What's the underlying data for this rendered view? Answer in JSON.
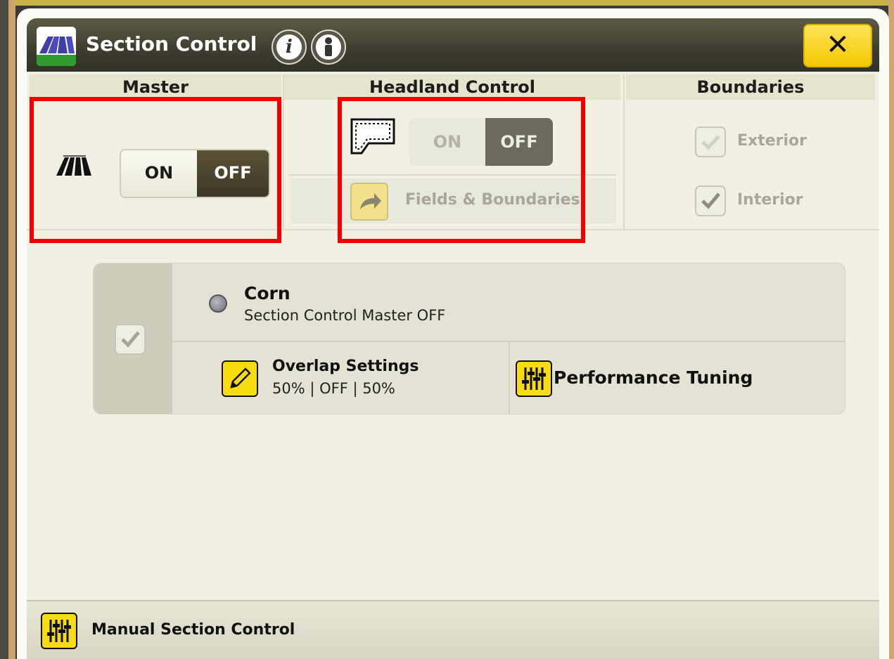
{
  "window": {
    "title": "Section Control",
    "close_symbol": "✕",
    "info_symbols": [
      "i",
      "i"
    ],
    "icons": [
      "section-control-app-icon",
      "info-icon",
      "operator-info-icon",
      "close-icon"
    ]
  },
  "master": {
    "header": "Master",
    "toggle": {
      "on_label": "ON",
      "off_label": "OFF",
      "selected": "OFF"
    }
  },
  "headland": {
    "header": "Headland Control",
    "toggle": {
      "on_label": "ON",
      "off_label": "OFF",
      "selected": "OFF",
      "enabled": false
    },
    "fields_button_label": "Fields & Boundaries"
  },
  "boundaries": {
    "header": "Boundaries",
    "options": [
      {
        "label": "Exterior",
        "checked": true,
        "enabled": false
      },
      {
        "label": "Interior",
        "checked": true,
        "enabled": false
      }
    ]
  },
  "crop": {
    "name": "Corn",
    "status": "Section Control Master OFF",
    "checked": true,
    "overlap": {
      "label": "Overlap Settings",
      "value": "50% | OFF | 50%"
    },
    "tuning": {
      "label": "Performance Tuning"
    }
  },
  "footer": {
    "manual_label": "Manual Section Control"
  },
  "colors": {
    "accent_yellow": "#f6dc10",
    "titlebar": "#3b3a2c",
    "highlight_red": "#f20000"
  }
}
